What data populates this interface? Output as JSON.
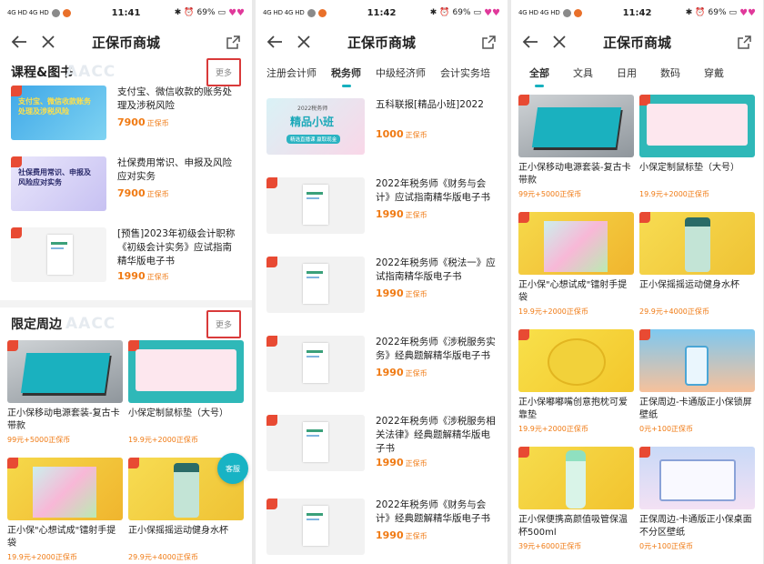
{
  "colors": {
    "accent": "#16b0be",
    "price": "#f07a13",
    "highlight_border": "#d93a3a",
    "badge": "#e84a33"
  },
  "panels": [
    {
      "status": {
        "signal": "4G HD 4G HD",
        "time": "11:41",
        "battery": "69%"
      },
      "title": "正保币商城",
      "section1": {
        "title": "课程&图书",
        "watermark": "AACC",
        "more": "更多",
        "items": [
          {
            "name": "支付宝、微信收款的账务处理及涉税风险",
            "price": "7900",
            "unit": "正保币",
            "cover_text": "支付宝、微信收款账务处理及涉税风险"
          },
          {
            "name": "社保费用常识、申报及风险应对实务",
            "price": "7900",
            "unit": "正保币",
            "cover_text": "社保费用常识、申报及风险应对实务"
          },
          {
            "name": "[预售]2023年初级会计职称《初级会计实务》应试指南精华版电子书",
            "price": "1990",
            "unit": "正保币",
            "cover_text": ""
          }
        ]
      },
      "section2": {
        "title": "限定周边",
        "watermark": "AACC",
        "more": "更多",
        "items": [
          {
            "name": "正小保移动电源套装-复古卡带款",
            "price": "99元+5000正保币"
          },
          {
            "name": "小保定制鼠标垫（大号）",
            "price": "19.9元+2000正保币"
          },
          {
            "name": "正小保\"心想试成\"镭射手提袋",
            "price": "19.9元+2000正保币"
          },
          {
            "name": "正小保摇摇运动健身水杯",
            "price": "29.9元+4000正保币"
          }
        ]
      },
      "kefu": "客服"
    },
    {
      "status": {
        "signal": "4G HD 4G HD",
        "time": "11:42",
        "battery": "69%"
      },
      "title": "正保币商城",
      "tabs": [
        "注册会计师",
        "税务师",
        "中级经济师",
        "会计实务培"
      ],
      "active_tab": "税务师",
      "items": [
        {
          "name": "五科联报[精品小班]2022",
          "price": "1000",
          "unit": "正保币",
          "cover_text": "精品小班",
          "cover_sub": "2022税务师",
          "cover_foot": "精选直播课  赢取现金"
        },
        {
          "name": "2022年税务师《财务与会计》应试指南精华版电子书",
          "price": "1990",
          "unit": "正保币"
        },
        {
          "name": "2022年税务师《税法一》应试指南精华版电子书",
          "price": "1990",
          "unit": "正保币"
        },
        {
          "name": "2022年税务师《涉税服务实务》经典题解精华版电子书",
          "price": "1990",
          "unit": "正保币"
        },
        {
          "name": "2022年税务师《涉税服务相关法律》经典题解精华版电子书",
          "price": "1990",
          "unit": "正保币"
        },
        {
          "name": "2022年税务师《财务与会计》经典题解精华版电子书",
          "price": "1990",
          "unit": "正保币"
        }
      ]
    },
    {
      "status": {
        "signal": "4G HD 4G HD",
        "time": "11:42",
        "battery": "69%"
      },
      "title": "正保币商城",
      "tabs": [
        "全部",
        "文具",
        "日用",
        "数码",
        "穿戴"
      ],
      "active_tab": "全部",
      "items": [
        {
          "name": "正小保移动电源套装-复古卡带款",
          "price": "99元+5000正保币"
        },
        {
          "name": "小保定制鼠标垫（大号）",
          "price": "19.9元+2000正保币"
        },
        {
          "name": "正小保\"心想试成\"镭射手提袋",
          "price": "19.9元+2000正保币"
        },
        {
          "name": "正小保摇摇运动健身水杯",
          "price": "29.9元+4000正保币"
        },
        {
          "name": "正小保嘟嘟嘴创意抱枕可爱靠垫",
          "price": "19.9元+2000正保币"
        },
        {
          "name": "正保周边-卡通版正小保锁屏壁纸",
          "price": "0元+100正保币"
        },
        {
          "name": "正小保便携高颜值吸管保温杯500ml",
          "price": "39元+6000正保币"
        },
        {
          "name": "正保周边-卡通版正小保桌面不分区壁纸",
          "price": "0元+100正保币"
        }
      ]
    }
  ]
}
